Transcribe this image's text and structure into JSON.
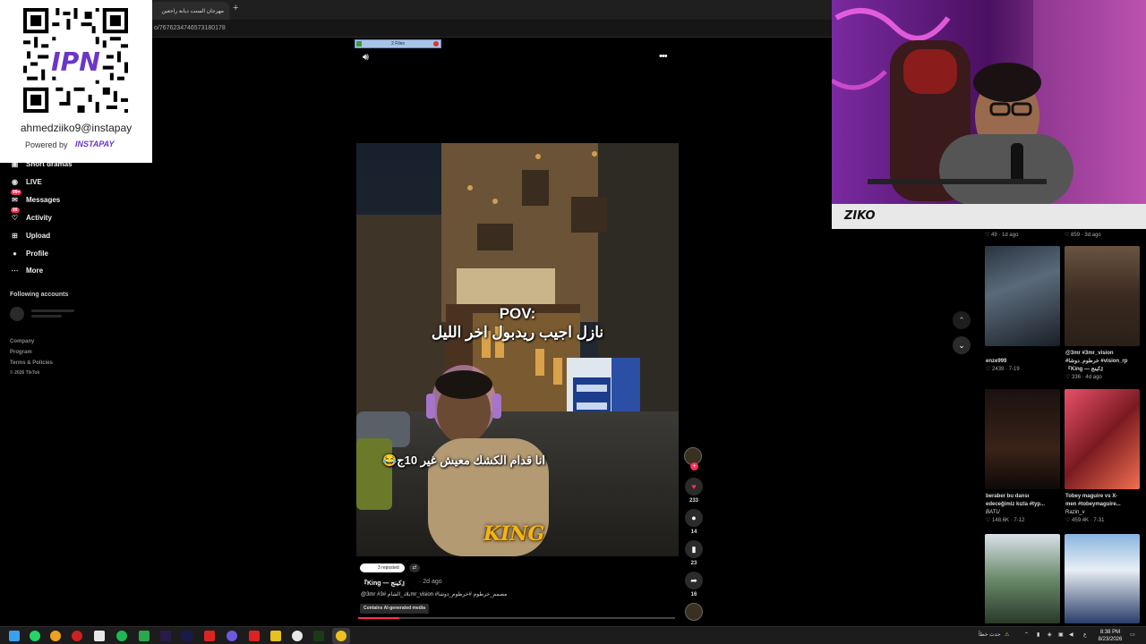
{
  "browser": {
    "tab_title": "مهرجان السنت ديابة راجعين",
    "new_tab": "+",
    "url": "o/7676234746573180178"
  },
  "qr_card": {
    "handle": "ahmedziiko9@instapay",
    "powered_by": "Powered by",
    "brand": "INSTAPAY"
  },
  "sidebar": {
    "items": [
      {
        "label": "Short dramas",
        "icon": "short-dramas-icon"
      },
      {
        "label": "LIVE",
        "icon": "live-icon"
      },
      {
        "label": "Messages",
        "icon": "messages-icon",
        "badge": "99+"
      },
      {
        "label": "Activity",
        "icon": "activity-icon",
        "badge": "99"
      },
      {
        "label": "Upload",
        "icon": "upload-icon"
      },
      {
        "label": "Profile",
        "icon": "profile-icon"
      },
      {
        "label": "More",
        "icon": "more-icon"
      }
    ],
    "following_title": "Following accounts",
    "footer": [
      "Company",
      "Program",
      "Terms & Policies",
      "© 2026 TikTok"
    ]
  },
  "downloads": {
    "label": "2 Files"
  },
  "video": {
    "pov_line1": "POV:",
    "pov_line2": "نازل اجيب ريدبول اخر الليل",
    "caption": "انا قدام الكشك معيش غير 10ج😂",
    "logo": "KING",
    "progress": 0.13
  },
  "rail": {
    "likes": "233",
    "comments": "14",
    "saves": "23",
    "shares": "16"
  },
  "post": {
    "reposted": "3 reposted",
    "author": "『King — كينج』",
    "date": "· 2d ago",
    "hashtags": "@3mr #بلاد_الشام #3mr_vision #مصمم_خرطوم #خرطوم_دوشا",
    "ai_label": "Contains AI-generated media"
  },
  "grid": [
    {
      "title": "",
      "meta": "♡ 49 · 1d ago"
    },
    {
      "title": "",
      "meta": "♡ 859 · 3d ago"
    },
    {
      "title": "enze999",
      "meta": "♡ 2439 · 7-19"
    },
    {
      "title": "@3mr #3mr_vision",
      "title2": "#خرطوم_دوشا #vision_rp",
      "title3": "『King — كينج』",
      "meta": "♡ 336 · 4d ago"
    },
    {
      "title": "beraber bu dansı",
      "title2": "edeceğimiz kızla #typ...",
      "title3": "BATU",
      "meta": "♡ 148.6K · 7-12"
    },
    {
      "title": "Tobey maguire vs X-",
      "title2": "men #tobeymaguire...",
      "title3": "Razin_v",
      "meta": "♡ 459.4K · 7-31"
    },
    {
      "title": "",
      "meta": ""
    },
    {
      "title": "",
      "meta": ""
    }
  ],
  "taskbar": {
    "time": "8:38 PM",
    "date": "8/23/2026",
    "lang": "ع",
    "weather": "حدث خطأ"
  },
  "colors": {
    "accent": "#fe2c55",
    "background": "#000000",
    "brand_purple": "#6b35c9"
  }
}
